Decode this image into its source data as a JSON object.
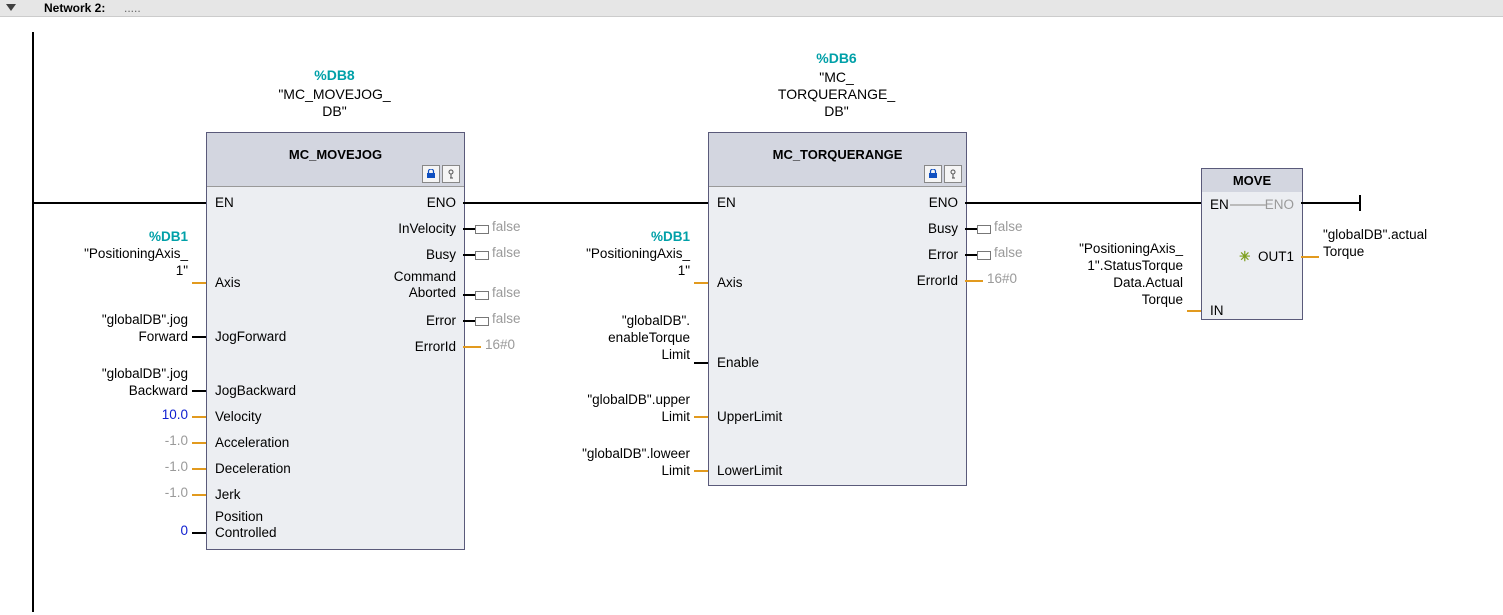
{
  "header": {
    "network": "Network 2:",
    "comment": "....."
  },
  "blocks": {
    "jog": {
      "db_id": "%DB8",
      "db_name_l1": "\"MC_MOVEJOG_",
      "db_name_l2": "DB\"",
      "title": "MC_MOVEJOG",
      "pins": {
        "en": "EN",
        "eno": "ENO",
        "axis": "Axis",
        "jogFwd": "JogForward",
        "jogBwd": "JogBackward",
        "vel": "Velocity",
        "acc": "Acceleration",
        "dec": "Deceleration",
        "jerk": "Jerk",
        "posc_l1": "Position",
        "posc_l2": "Controlled",
        "inVel": "InVelocity",
        "busy": "Busy",
        "cab_l1": "Command",
        "cab_l2": "Aborted",
        "err": "Error",
        "errId": "ErrorId"
      },
      "in": {
        "axis_db": "%DB1",
        "axis_l1": "\"PositioningAxis_",
        "axis_l2": "1\"",
        "jogFwd_l1": "\"globalDB\".jog",
        "jogFwd_l2": "Forward",
        "jogBwd_l1": "\"globalDB\".jog",
        "jogBwd_l2": "Backward",
        "vel": "10.0",
        "acc": "-1.0",
        "dec": "-1.0",
        "jerk": "-1.0",
        "posc": "0"
      },
      "out": {
        "inVel": "false",
        "busy": "false",
        "cab": "false",
        "err": "false",
        "errId": "16#0"
      }
    },
    "torq": {
      "db_id": "%DB6",
      "db_name_l1": "\"MC_",
      "db_name_l2": "TORQUERANGE_",
      "db_name_l3": "DB\"",
      "title": "MC_TORQUERANGE",
      "pins": {
        "en": "EN",
        "eno": "ENO",
        "axis": "Axis",
        "enable": "Enable",
        "upper": "UpperLimit",
        "lower": "LowerLimit",
        "busy": "Busy",
        "err": "Error",
        "errId": "ErrorId"
      },
      "in": {
        "axis_db": "%DB1",
        "axis_l1": "\"PositioningAxis_",
        "axis_l2": "1\"",
        "enable_l1": "\"globalDB\".",
        "enable_l2": "enableTorque",
        "enable_l3": "Limit",
        "upper_l1": "\"globalDB\".upper",
        "upper_l2": "Limit",
        "lower_l1": "\"globalDB\".loweer",
        "lower_l2": "Limit"
      },
      "out": {
        "busy": "false",
        "err": "false",
        "errId": "16#0"
      }
    },
    "move": {
      "title": "MOVE",
      "en": "EN",
      "eno": "ENO",
      "in": "IN",
      "out": "OUT1",
      "inval_l1": "\"PositioningAxis_",
      "inval_l2": "1\".StatusTorque",
      "inval_l3": "Data.Actual",
      "inval_l4": "Torque",
      "outval_l1": "\"globalDB\".actual",
      "outval_l2": "Torque"
    }
  },
  "icons": {
    "lock": "lock-icon",
    "param": "param-icon"
  }
}
